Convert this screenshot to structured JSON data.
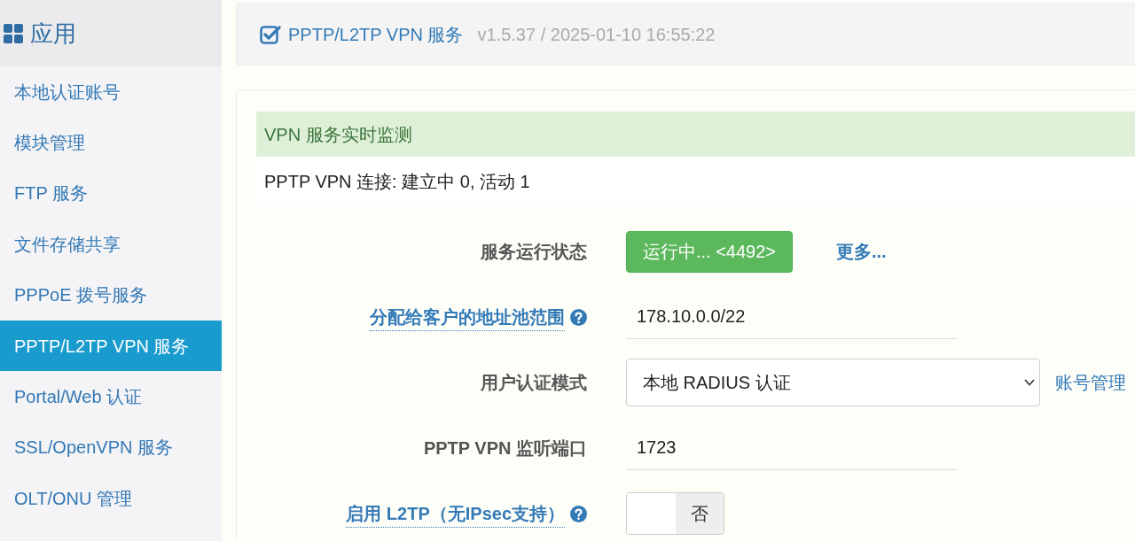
{
  "sidebar": {
    "title": "应用",
    "items": [
      {
        "label": "本地认证账号",
        "selected": false
      },
      {
        "label": "模块管理",
        "selected": false
      },
      {
        "label": "FTP 服务",
        "selected": false
      },
      {
        "label": "文件存储共享",
        "selected": false
      },
      {
        "label": "PPPoE 拨号服务",
        "selected": false
      },
      {
        "label": "PPTP/L2TP VPN 服务",
        "selected": true
      },
      {
        "label": "Portal/Web 认证",
        "selected": false
      },
      {
        "label": "SSL/OpenVPN 服务",
        "selected": false
      },
      {
        "label": "OLT/ONU 管理",
        "selected": false
      }
    ]
  },
  "header": {
    "title": "PPTP/L2TP VPN 服务",
    "version": "v1.5.37 / 2025-01-10 16:55:22"
  },
  "monitor": {
    "title": "VPN 服务实时监测",
    "status": "PPTP VPN 连接: 建立中 0, 活动 1"
  },
  "form": {
    "rows": [
      {
        "kind": "status",
        "label": "服务运行状态",
        "help": false,
        "button": "运行中... <4492>",
        "link": "更多..."
      },
      {
        "kind": "text",
        "label": "分配给客户的地址池范围",
        "help": true,
        "value": "178.10.0.0/22"
      },
      {
        "kind": "select",
        "label": "用户认证模式",
        "help": false,
        "value": "本地 RADIUS 认证",
        "link": "账号管理"
      },
      {
        "kind": "text",
        "label": "PPTP VPN 监听端口",
        "help": false,
        "value": "1723"
      },
      {
        "kind": "toggle",
        "label": "启用 L2TP（无IPsec支持）",
        "help": true,
        "on": false,
        "state_text": "否"
      }
    ]
  }
}
